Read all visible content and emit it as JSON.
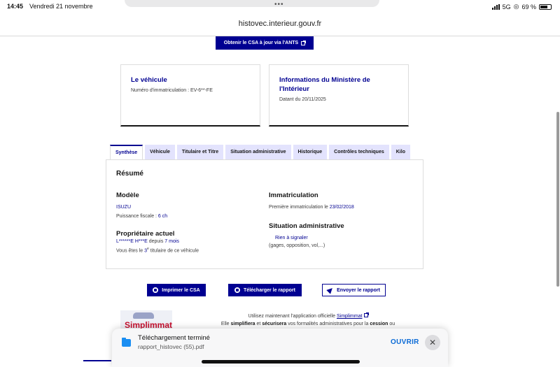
{
  "status_bar": {
    "time": "14:45",
    "date": "Vendredi 21 novembre",
    "network": "5G",
    "battery": "69 %"
  },
  "browser": {
    "url": "histovec.interieur.gouv.fr"
  },
  "csa_button": {
    "label": "Obtenir le CSA à jour via l'ANTS"
  },
  "card_vehicule": {
    "title": "Le véhicule",
    "line": "Numéro d'immatriculation : EV-6**-FE"
  },
  "card_ministere": {
    "title": "Informations du Ministère de l'Intérieur",
    "line": "Datant du 20/11/2025"
  },
  "tabs": [
    {
      "label": "Synthèse"
    },
    {
      "label": "Véhicule"
    },
    {
      "label": "Titulaire et Titre"
    },
    {
      "label": "Situation administrative"
    },
    {
      "label": "Historique"
    },
    {
      "label": "Contrôles techniques"
    },
    {
      "label": "Kilo"
    }
  ],
  "summary": {
    "title": "Résumé",
    "modele": {
      "heading": "Modèle",
      "brand": "ISUZU",
      "power_label": "Puissance fiscale : ",
      "power_value": "6 ch"
    },
    "proprietaire": {
      "heading": "Propriétaire actuel",
      "name": "L******E H***E",
      "since_label": " depuis ",
      "since_value": "7 mois",
      "rank_prefix": "Vous êtes le ",
      "rank_value": "3",
      "rank_suffix": "e",
      "rank_end": " titulaire de ce véhicule"
    },
    "immatriculation": {
      "heading": "Immatriculation",
      "label": "Première immatriculation le ",
      "date": "23/02/2018"
    },
    "situation": {
      "heading": "Situation administrative",
      "status": "Rien à signaler",
      "detail": "(gages, opposition, vol,...)"
    }
  },
  "actions": {
    "print": "Imprimer le CSA",
    "download": "Télécharger le rapport",
    "send": "Envoyer le rapport"
  },
  "simplimmat": {
    "logo_text": "Simplimmat",
    "line1_prefix": "Utilisez maintenant l'application officielle ",
    "line1_link": "Simplimmat",
    "line2_a": "Elle ",
    "line2_b": "simplifiera",
    "line2_c": " et ",
    "line2_d": "sécurisera",
    "line2_e": " vos formalités administratives pour la ",
    "line2_f": "cession",
    "line2_g": " ou"
  },
  "download_toast": {
    "title": "Téléchargement terminé",
    "filename": "rapport_histovec (55).pdf",
    "open_label": "OUVRIR"
  },
  "colors": {
    "primary": "#000091",
    "tab_bg": "#e3e3fd",
    "toast_link": "#0a6ad6"
  }
}
